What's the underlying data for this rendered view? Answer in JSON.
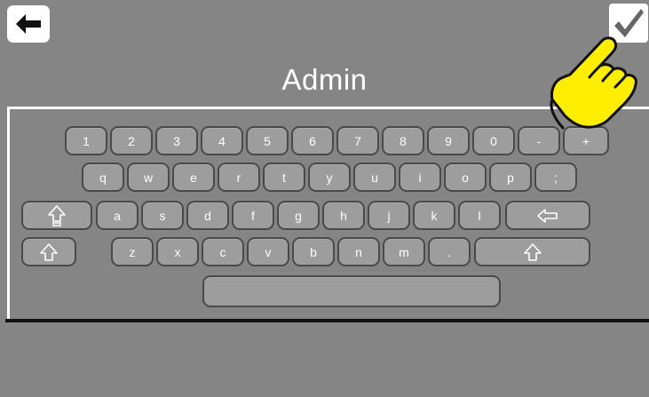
{
  "header": {
    "title": "Admin",
    "back_icon": "arrow-left-icon",
    "confirm_icon": "checkmark-icon"
  },
  "keyboard": {
    "row1": [
      "1",
      "2",
      "3",
      "4",
      "5",
      "6",
      "7",
      "8",
      "9",
      "0",
      "-",
      "+"
    ],
    "row2": [
      "q",
      "w",
      "e",
      "r",
      "t",
      "y",
      "u",
      "i",
      "o",
      "p",
      ";"
    ],
    "row3": [
      "a",
      "s",
      "d",
      "f",
      "g",
      "h",
      "j",
      "k",
      "l"
    ],
    "row4": [
      "z",
      "x",
      "c",
      "v",
      "b",
      "n",
      "m",
      "."
    ],
    "icons": {
      "caps_lock": "caps-lock-icon",
      "backspace": "backspace-icon",
      "shift": "shift-icon"
    }
  },
  "colors": {
    "background": "#858585",
    "key": "#9d9d9d",
    "key_border": "#4a4a4a",
    "pointer_hand": "#ffee00"
  }
}
